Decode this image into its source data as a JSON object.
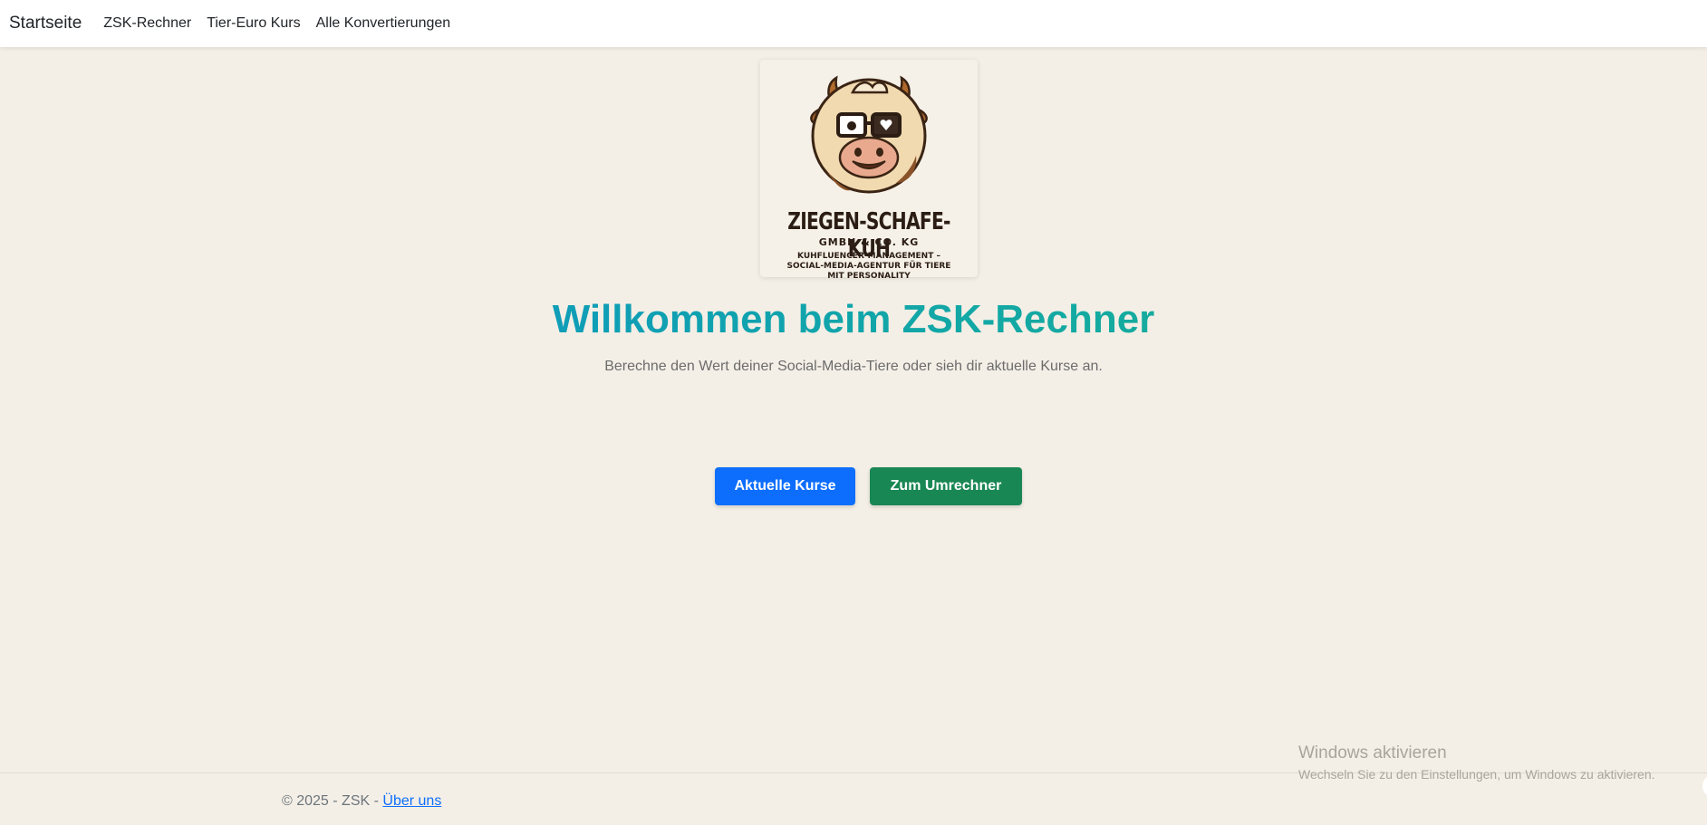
{
  "navbar": {
    "brand": "Startseite",
    "links": [
      "ZSK-Rechner",
      "Tier-Euro Kurs",
      "Alle Konvertierungen"
    ]
  },
  "logo": {
    "title": "ZIEGEN-SCHAFE-KUH",
    "subtitle": "GMBH & CO. KG",
    "tagline_line1": "KUHFLUENCER-MANAGEMENT –",
    "tagline_line2": "SOCIAL-MEDIA-AGENTUR FÜR TIERE",
    "tagline_line3": "MIT PERSONALITY"
  },
  "hero": {
    "title": "Willkommen beim ZSK-Rechner",
    "lead": "Berechne den Wert deiner Social-Media-Tiere oder sieh dir aktuelle Kurse an."
  },
  "buttons": {
    "primary_label": "Aktuelle Kurse",
    "success_label": "Zum Umrechner"
  },
  "footer": {
    "copyright": "© 2025 - ZSK - ",
    "about_link": "Über uns"
  },
  "windows_watermark": {
    "title": "Windows aktivieren",
    "subtitle": "Wechseln Sie zu den Einstellungen, um Windows zu aktivieren."
  },
  "colors": {
    "background": "#f4efe6",
    "primary": "#0d6efd",
    "success": "#198754",
    "heading_gradient_start": "#0a8fd0",
    "heading_gradient_end": "#1fb58a"
  }
}
